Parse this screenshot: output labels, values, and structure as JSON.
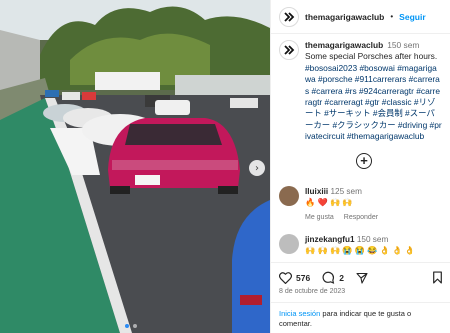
{
  "post": {
    "username": "themagarigawaclub",
    "follow_label": "Seguir",
    "caption_time": "150 sem",
    "caption_text": "Some special Porsches after hours.",
    "hashtags": "#bososai2023 #bosowai #magarigawa #porsche #911carrerars #carreras #carrera #rs #924carreragtr #carreragtr #carreragt #gtr #classic #リゾート #サーキット #会員制 #スーパーカー #クラシックカー #driving #privatecircuit #themagarigawaclub",
    "likes": "576",
    "comments_count": "2",
    "date": "8 de octubre de 2023",
    "login_link": "Inicia sesión",
    "login_text": " para indicar que te gusta o comentar."
  },
  "comments": [
    {
      "user": "lluixiii",
      "time": "125 sem",
      "text": "🔥 ❤️ 🙌 🙌",
      "like_label": "Me gusta",
      "reply_label": "Responder",
      "avatar_color": "#8a6a4f"
    },
    {
      "user": "jinzekangfu1",
      "time": "150 sem",
      "text": "🙌 🙌 🙌 😭 😭 😂 👌 👌 👌",
      "avatar_color": "#bdbdbd"
    }
  ],
  "icons": {
    "heart": "heart-icon",
    "comment": "comment-icon",
    "share": "share-icon",
    "bookmark": "bookmark-icon",
    "next": "chevron-right-icon",
    "add": "plus-circle-icon"
  },
  "colors": {
    "link_blue": "#0095f6",
    "hashtag_blue": "#00376b",
    "car_magenta": "#c2185b"
  }
}
